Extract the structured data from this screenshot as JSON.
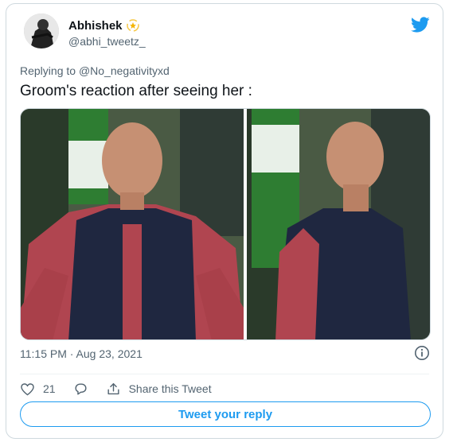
{
  "user": {
    "display_name": "Abhishek",
    "handle": "@abhi_tweetz_",
    "badge_icon": "dizzy-star-icon"
  },
  "reply": {
    "prefix": "Replying to",
    "mention": "@No_negativityxd"
  },
  "tweet": {
    "text": "Groom's reaction after seeing her :",
    "timestamp": "11:15 PM · Aug 23, 2021"
  },
  "actions": {
    "like_count": "21",
    "share_label": "Share this Tweet"
  },
  "reply_button": {
    "label": "Tweet your reply"
  },
  "colors": {
    "accent": "#1d9bf0",
    "secondary_text": "#536471",
    "border": "#cfd9de"
  }
}
